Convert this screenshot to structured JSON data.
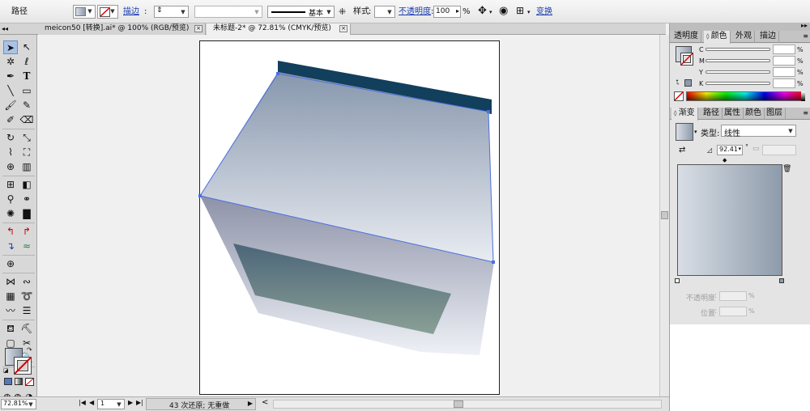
{
  "control_bar": {
    "object_label": "路径",
    "stroke_label": "描边",
    "stroke_value": "",
    "stroke_style_label": "基本",
    "style_label": "样式",
    "opacity_label": "不透明度",
    "opacity_value": "100",
    "opacity_unit": "%",
    "transform_label": "变换"
  },
  "doc_tabs": [
    {
      "label": "meicon50 [转换].ai* @ 100% (RGB/预览)",
      "close": "×"
    },
    {
      "label": "未标题-2* @ 72.81% (CMYK/预览)",
      "close": "×"
    }
  ],
  "status_bar": {
    "zoom": "72.81%",
    "page": "1",
    "history_text": "43 次还原; 无重做",
    "nav_first": "|◀",
    "nav_prev": "◀",
    "nav_next": "▶",
    "nav_last": "▶|",
    "play": "▶",
    "scroll_left": "<"
  },
  "color_panel": {
    "tabs": [
      "透明度",
      "颜色",
      "外观",
      "描边"
    ],
    "active_tab": "颜色",
    "channels": [
      "C",
      "M",
      "Y",
      "K"
    ],
    "unit": "%"
  },
  "gradient_panel": {
    "tabs": [
      "渐变",
      "路径",
      "属性",
      "颜色",
      "图层"
    ],
    "active_tab": "渐变",
    "type_label": "类型:",
    "type_value": "线性",
    "angle_value": "92.41",
    "angle_unit": "°",
    "opacity_label": "不透明度",
    "position_label": "位置",
    "unit": "%"
  },
  "toolbox": {
    "collapse_arrows": "◂◂"
  },
  "panel_header": {
    "collapse_arrows": "▸▸"
  },
  "colors": {
    "gradient_start": "#d9dee5",
    "gradient_end": "#8e9bab",
    "selection_blue": "#4a6fe0",
    "top_face": "#123f5c"
  }
}
